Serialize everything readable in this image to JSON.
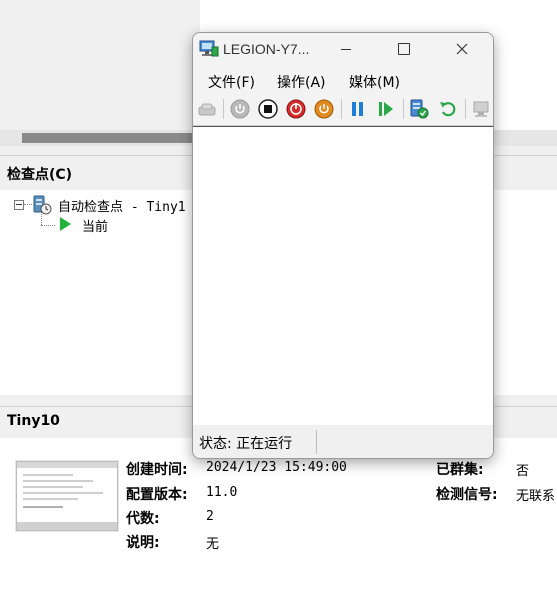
{
  "checkpoints": {
    "title": "检查点(C)",
    "root_label": "自动检查点 - Tiny1",
    "child_label": "当前"
  },
  "vm": {
    "name": "Tiny10",
    "created_label": "创建时间:",
    "created_value": "2024/1/23 15:49:00",
    "config_label": "配置版本:",
    "config_value": "11.0",
    "generation_label": "代数:",
    "generation_value": "2",
    "notes_label": "说明:",
    "notes_value": "无",
    "clustered_label": "已群集:",
    "clustered_value": "否",
    "heartbeat_label": "检测信号:",
    "heartbeat_value": "无联系"
  },
  "window": {
    "title": "LEGION-Y7...",
    "menus": [
      "文件(F)",
      "操作(A)",
      "媒体(M)"
    ],
    "status": "状态: 正在运行"
  },
  "icons": {
    "ctrl_alt_del": "ctrl-alt-del-icon",
    "start": "start-icon",
    "turn_off": "turn-off-icon",
    "shutdown": "shutdown-icon",
    "save": "save-icon",
    "pause": "pause-icon",
    "resume": "resume-icon",
    "checkpoint": "checkpoint-icon",
    "revert": "revert-icon",
    "enhanced_session": "enhanced-session-icon"
  },
  "colors": {
    "shutdown_red": "#d62b2b",
    "save_orange": "#e08a1e",
    "pause_blue": "#1f7fd6",
    "resume_green": "#2ba84a"
  }
}
